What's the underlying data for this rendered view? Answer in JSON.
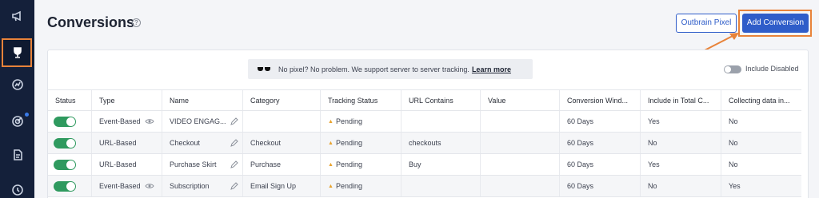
{
  "header": {
    "title": "Conversions",
    "help_icon": "?",
    "outbrain_pixel_label": "Outbrain Pixel",
    "add_conversion_label": "Add Conversion"
  },
  "sidebar": {
    "items": [
      {
        "icon": "megaphone-icon"
      },
      {
        "icon": "trophy-icon",
        "active": true
      },
      {
        "icon": "analytics-icon"
      },
      {
        "icon": "target-icon",
        "notification": true
      },
      {
        "icon": "document-icon"
      },
      {
        "icon": "clock-icon"
      }
    ]
  },
  "banner": {
    "text": "No pixel? No problem. We support server to server tracking.",
    "link": "Learn more"
  },
  "include_disabled": {
    "label": "Include Disabled",
    "enabled": false
  },
  "table": {
    "columns": [
      "Status",
      "Type",
      "Name",
      "Category",
      "Tracking Status",
      "URL Contains",
      "Value",
      "Conversion Wind...",
      "Include in Total C...",
      "Collecting data in..."
    ],
    "rows": [
      {
        "type": "Event-Based",
        "name": "VIDEO ENGAG...",
        "category": "",
        "tracking": "Pending",
        "url": "",
        "value": "",
        "window": "60 Days",
        "include": "Yes",
        "collecting": "No"
      },
      {
        "type": "URL-Based",
        "name": "Checkout",
        "category": "Checkout",
        "tracking": "Pending",
        "url": "checkouts",
        "value": "",
        "window": "60 Days",
        "include": "No",
        "collecting": "No"
      },
      {
        "type": "URL-Based",
        "name": "Purchase Skirt",
        "category": "Purchase",
        "tracking": "Pending",
        "url": "Buy",
        "value": "",
        "window": "60 Days",
        "include": "Yes",
        "collecting": "No"
      },
      {
        "type": "Event-Based",
        "name": "Subscription",
        "category": "Email Sign Up",
        "tracking": "Pending",
        "url": "",
        "value": "",
        "window": "60 Days",
        "include": "No",
        "collecting": "Yes"
      }
    ]
  },
  "colors": {
    "sidebar_bg": "#14203a",
    "primary": "#2f5dc9",
    "highlight": "#e8833a",
    "status_on": "#2f9a5f",
    "pending": "#e8a32e"
  }
}
